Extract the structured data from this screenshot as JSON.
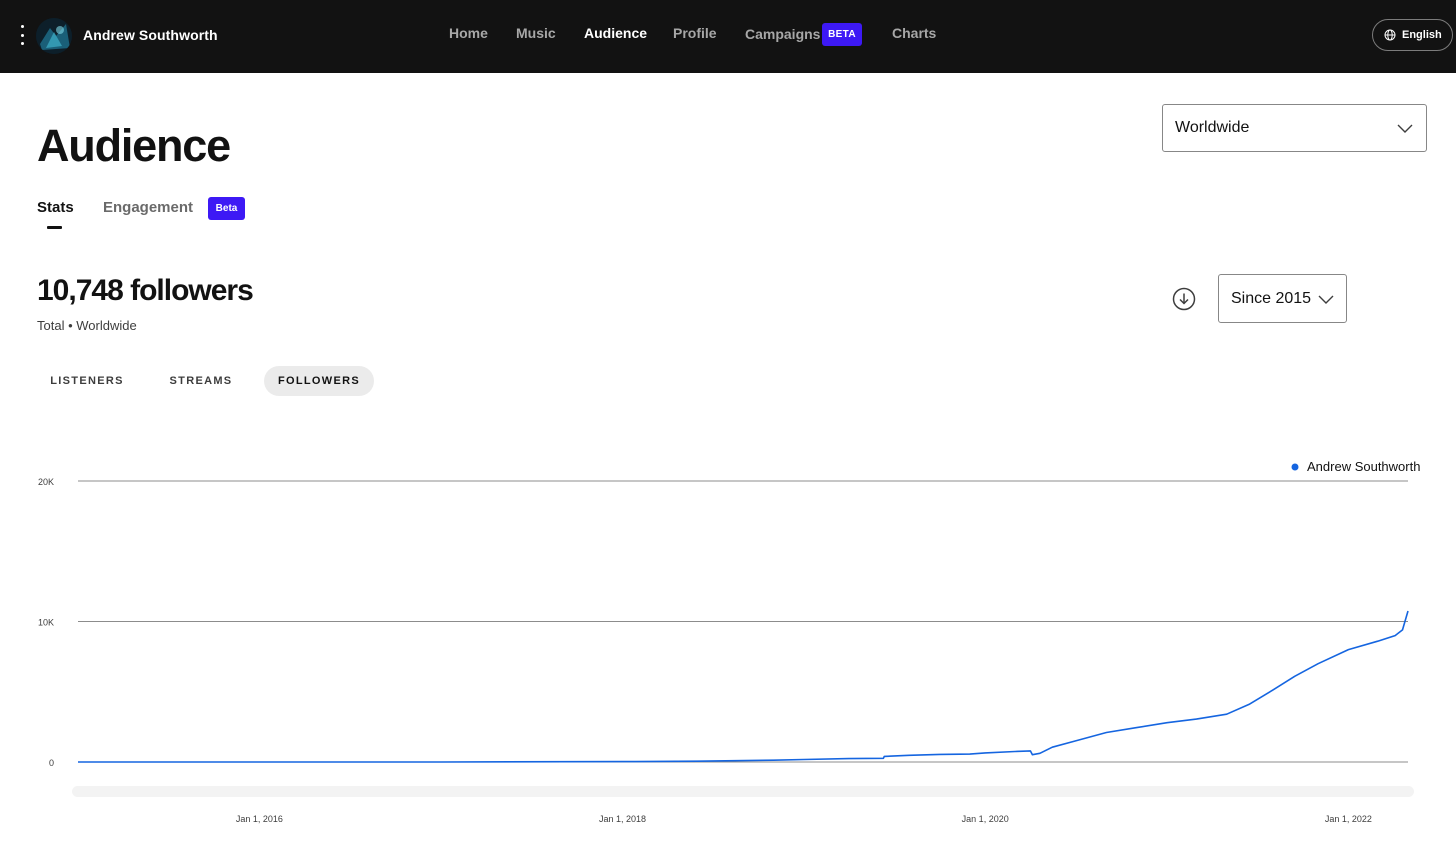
{
  "header": {
    "artist_name": "Andrew Southworth",
    "nav": [
      {
        "label": "Home",
        "active": false
      },
      {
        "label": "Music",
        "active": false
      },
      {
        "label": "Audience",
        "active": true
      },
      {
        "label": "Profile",
        "active": false
      },
      {
        "label": "Campaigns",
        "active": false,
        "badge": "BETA"
      },
      {
        "label": "Charts",
        "active": false
      }
    ],
    "language": "English",
    "icons": {
      "menu": "kebab-menu-icon",
      "language": "globe-icon",
      "avatar": "artist-avatar"
    }
  },
  "page": {
    "title": "Audience",
    "region_select": {
      "value": "Worldwide"
    },
    "subtabs": [
      {
        "label": "Stats",
        "active": true
      },
      {
        "label": "Engagement",
        "active": false,
        "badge": "Beta"
      }
    ],
    "stat": {
      "value": "10,748 followers",
      "subtitle": "Total • Worldwide"
    },
    "range_select": {
      "value": "Since 2015"
    },
    "metric_tabs": [
      {
        "label": "LISTENERS",
        "active": false
      },
      {
        "label": "STREAMS",
        "active": false
      },
      {
        "label": "FOLLOWERS",
        "active": true
      }
    ]
  },
  "colors": {
    "topbar": "#121212",
    "accent_purple": "#3d19f5",
    "series": "#1565e0"
  },
  "chart_data": {
    "type": "line",
    "title": "",
    "xlabel": "",
    "ylabel": "",
    "ylim": [
      0,
      20000
    ],
    "yticks": [
      0,
      10000,
      20000
    ],
    "ytick_labels": [
      "0",
      "10K",
      "20K"
    ],
    "xlim": [
      "2015-01-01",
      "2022-05-01"
    ],
    "xticks": [
      "2016-01-01",
      "2018-01-01",
      "2020-01-01",
      "2022-01-01"
    ],
    "xtick_labels": [
      "Jan 1, 2016",
      "Jan 1, 2018",
      "Jan 1, 2020",
      "Jan 1, 2022"
    ],
    "grid": true,
    "legend": "top-right",
    "series": [
      {
        "name": "Andrew Southworth",
        "points": [
          [
            "2015-01-01",
            0
          ],
          [
            "2017-01-01",
            0
          ],
          [
            "2018-01-01",
            30
          ],
          [
            "2018-06-01",
            60
          ],
          [
            "2018-11-01",
            130
          ],
          [
            "2019-01-01",
            180
          ],
          [
            "2019-04-01",
            240
          ],
          [
            "2019-06-10",
            260
          ],
          [
            "2019-06-12",
            400
          ],
          [
            "2019-08-01",
            480
          ],
          [
            "2019-10-01",
            540
          ],
          [
            "2019-12-01",
            560
          ],
          [
            "2020-01-01",
            650
          ],
          [
            "2020-03-01",
            750
          ],
          [
            "2020-04-01",
            790
          ],
          [
            "2020-04-05",
            520
          ],
          [
            "2020-04-20",
            620
          ],
          [
            "2020-05-15",
            1050
          ],
          [
            "2020-07-01",
            1500
          ],
          [
            "2020-09-01",
            2100
          ],
          [
            "2020-11-01",
            2450
          ],
          [
            "2021-01-01",
            2800
          ],
          [
            "2021-03-01",
            3050
          ],
          [
            "2021-05-01",
            3400
          ],
          [
            "2021-06-15",
            4100
          ],
          [
            "2021-08-01",
            5100
          ],
          [
            "2021-09-15",
            6100
          ],
          [
            "2021-11-01",
            7000
          ],
          [
            "2022-01-01",
            8000
          ],
          [
            "2022-03-01",
            8600
          ],
          [
            "2022-04-05",
            9000
          ],
          [
            "2022-04-20",
            9400
          ],
          [
            "2022-05-01",
            10748
          ]
        ]
      }
    ]
  }
}
